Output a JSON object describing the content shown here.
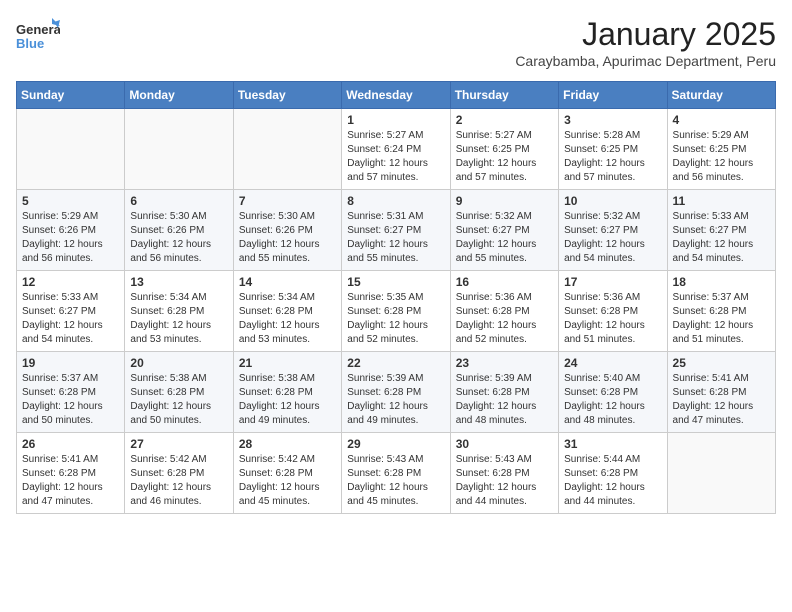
{
  "logo": {
    "general": "General",
    "blue": "Blue"
  },
  "header": {
    "month": "January 2025",
    "location": "Caraybamba, Apurimac Department, Peru"
  },
  "weekdays": [
    "Sunday",
    "Monday",
    "Tuesday",
    "Wednesday",
    "Thursday",
    "Friday",
    "Saturday"
  ],
  "weeks": [
    [
      {
        "day": "",
        "sunrise": "",
        "sunset": "",
        "daylight": ""
      },
      {
        "day": "",
        "sunrise": "",
        "sunset": "",
        "daylight": ""
      },
      {
        "day": "",
        "sunrise": "",
        "sunset": "",
        "daylight": ""
      },
      {
        "day": "1",
        "sunrise": "Sunrise: 5:27 AM",
        "sunset": "Sunset: 6:24 PM",
        "daylight": "Daylight: 12 hours and 57 minutes."
      },
      {
        "day": "2",
        "sunrise": "Sunrise: 5:27 AM",
        "sunset": "Sunset: 6:25 PM",
        "daylight": "Daylight: 12 hours and 57 minutes."
      },
      {
        "day": "3",
        "sunrise": "Sunrise: 5:28 AM",
        "sunset": "Sunset: 6:25 PM",
        "daylight": "Daylight: 12 hours and 57 minutes."
      },
      {
        "day": "4",
        "sunrise": "Sunrise: 5:29 AM",
        "sunset": "Sunset: 6:25 PM",
        "daylight": "Daylight: 12 hours and 56 minutes."
      }
    ],
    [
      {
        "day": "5",
        "sunrise": "Sunrise: 5:29 AM",
        "sunset": "Sunset: 6:26 PM",
        "daylight": "Daylight: 12 hours and 56 minutes."
      },
      {
        "day": "6",
        "sunrise": "Sunrise: 5:30 AM",
        "sunset": "Sunset: 6:26 PM",
        "daylight": "Daylight: 12 hours and 56 minutes."
      },
      {
        "day": "7",
        "sunrise": "Sunrise: 5:30 AM",
        "sunset": "Sunset: 6:26 PM",
        "daylight": "Daylight: 12 hours and 55 minutes."
      },
      {
        "day": "8",
        "sunrise": "Sunrise: 5:31 AM",
        "sunset": "Sunset: 6:27 PM",
        "daylight": "Daylight: 12 hours and 55 minutes."
      },
      {
        "day": "9",
        "sunrise": "Sunrise: 5:32 AM",
        "sunset": "Sunset: 6:27 PM",
        "daylight": "Daylight: 12 hours and 55 minutes."
      },
      {
        "day": "10",
        "sunrise": "Sunrise: 5:32 AM",
        "sunset": "Sunset: 6:27 PM",
        "daylight": "Daylight: 12 hours and 54 minutes."
      },
      {
        "day": "11",
        "sunrise": "Sunrise: 5:33 AM",
        "sunset": "Sunset: 6:27 PM",
        "daylight": "Daylight: 12 hours and 54 minutes."
      }
    ],
    [
      {
        "day": "12",
        "sunrise": "Sunrise: 5:33 AM",
        "sunset": "Sunset: 6:27 PM",
        "daylight": "Daylight: 12 hours and 54 minutes."
      },
      {
        "day": "13",
        "sunrise": "Sunrise: 5:34 AM",
        "sunset": "Sunset: 6:28 PM",
        "daylight": "Daylight: 12 hours and 53 minutes."
      },
      {
        "day": "14",
        "sunrise": "Sunrise: 5:34 AM",
        "sunset": "Sunset: 6:28 PM",
        "daylight": "Daylight: 12 hours and 53 minutes."
      },
      {
        "day": "15",
        "sunrise": "Sunrise: 5:35 AM",
        "sunset": "Sunset: 6:28 PM",
        "daylight": "Daylight: 12 hours and 52 minutes."
      },
      {
        "day": "16",
        "sunrise": "Sunrise: 5:36 AM",
        "sunset": "Sunset: 6:28 PM",
        "daylight": "Daylight: 12 hours and 52 minutes."
      },
      {
        "day": "17",
        "sunrise": "Sunrise: 5:36 AM",
        "sunset": "Sunset: 6:28 PM",
        "daylight": "Daylight: 12 hours and 51 minutes."
      },
      {
        "day": "18",
        "sunrise": "Sunrise: 5:37 AM",
        "sunset": "Sunset: 6:28 PM",
        "daylight": "Daylight: 12 hours and 51 minutes."
      }
    ],
    [
      {
        "day": "19",
        "sunrise": "Sunrise: 5:37 AM",
        "sunset": "Sunset: 6:28 PM",
        "daylight": "Daylight: 12 hours and 50 minutes."
      },
      {
        "day": "20",
        "sunrise": "Sunrise: 5:38 AM",
        "sunset": "Sunset: 6:28 PM",
        "daylight": "Daylight: 12 hours and 50 minutes."
      },
      {
        "day": "21",
        "sunrise": "Sunrise: 5:38 AM",
        "sunset": "Sunset: 6:28 PM",
        "daylight": "Daylight: 12 hours and 49 minutes."
      },
      {
        "day": "22",
        "sunrise": "Sunrise: 5:39 AM",
        "sunset": "Sunset: 6:28 PM",
        "daylight": "Daylight: 12 hours and 49 minutes."
      },
      {
        "day": "23",
        "sunrise": "Sunrise: 5:39 AM",
        "sunset": "Sunset: 6:28 PM",
        "daylight": "Daylight: 12 hours and 48 minutes."
      },
      {
        "day": "24",
        "sunrise": "Sunrise: 5:40 AM",
        "sunset": "Sunset: 6:28 PM",
        "daylight": "Daylight: 12 hours and 48 minutes."
      },
      {
        "day": "25",
        "sunrise": "Sunrise: 5:41 AM",
        "sunset": "Sunset: 6:28 PM",
        "daylight": "Daylight: 12 hours and 47 minutes."
      }
    ],
    [
      {
        "day": "26",
        "sunrise": "Sunrise: 5:41 AM",
        "sunset": "Sunset: 6:28 PM",
        "daylight": "Daylight: 12 hours and 47 minutes."
      },
      {
        "day": "27",
        "sunrise": "Sunrise: 5:42 AM",
        "sunset": "Sunset: 6:28 PM",
        "daylight": "Daylight: 12 hours and 46 minutes."
      },
      {
        "day": "28",
        "sunrise": "Sunrise: 5:42 AM",
        "sunset": "Sunset: 6:28 PM",
        "daylight": "Daylight: 12 hours and 45 minutes."
      },
      {
        "day": "29",
        "sunrise": "Sunrise: 5:43 AM",
        "sunset": "Sunset: 6:28 PM",
        "daylight": "Daylight: 12 hours and 45 minutes."
      },
      {
        "day": "30",
        "sunrise": "Sunrise: 5:43 AM",
        "sunset": "Sunset: 6:28 PM",
        "daylight": "Daylight: 12 hours and 44 minutes."
      },
      {
        "day": "31",
        "sunrise": "Sunrise: 5:44 AM",
        "sunset": "Sunset: 6:28 PM",
        "daylight": "Daylight: 12 hours and 44 minutes."
      },
      {
        "day": "",
        "sunrise": "",
        "sunset": "",
        "daylight": ""
      }
    ]
  ]
}
